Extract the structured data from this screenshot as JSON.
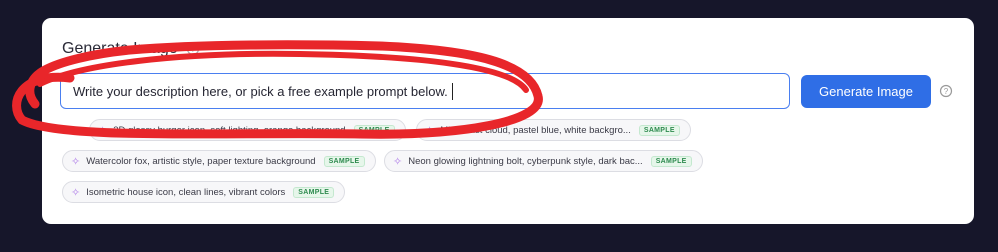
{
  "card": {
    "title": "Generate Image",
    "prompt": {
      "value": "Write your description here, or pick a free example prompt below."
    },
    "generate_button": "Generate Image",
    "try_label": "TRY:",
    "examples": [
      {
        "text": "3D glossy burger icon, soft lighting, orange background",
        "badge": "SAMPLE"
      },
      {
        "text": "Minimalist cloud, pastel blue, white backgro...",
        "badge": "SAMPLE"
      },
      {
        "text": "Watercolor fox, artistic style, paper texture background",
        "badge": "SAMPLE"
      },
      {
        "text": "Neon glowing lightning bolt, cyberpunk style, dark bac...",
        "badge": "SAMPLE"
      },
      {
        "text": "Isometric house icon, clean lines, vibrant colors",
        "badge": "SAMPLE"
      }
    ]
  },
  "colors": {
    "background": "#16162a",
    "accent": "#2f6ee6",
    "annotation": "#e8262a",
    "sample_badge": "#2e8b4f"
  },
  "icons": [
    "info-icon",
    "help-icon",
    "sparkle-icon"
  ]
}
